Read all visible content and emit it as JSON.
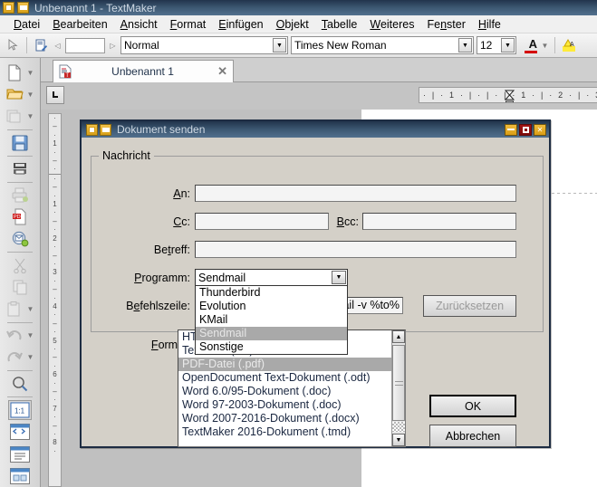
{
  "window": {
    "title": "Unbenannt 1 - TextMaker",
    "icons": [
      "app-grid-icon",
      "window-restore-icon"
    ]
  },
  "menubar": {
    "items": [
      {
        "label": "Datei",
        "accel": "D"
      },
      {
        "label": "Bearbeiten",
        "accel": "B"
      },
      {
        "label": "Ansicht",
        "accel": "A"
      },
      {
        "label": "Format",
        "accel": "F"
      },
      {
        "label": "Einfügen",
        "accel": "E"
      },
      {
        "label": "Objekt",
        "accel": "O"
      },
      {
        "label": "Tabelle",
        "accel": "T"
      },
      {
        "label": "Weiteres",
        "accel": "W"
      },
      {
        "label": "Fenster",
        "accel": "n"
      },
      {
        "label": "Hilfe",
        "accel": "H"
      }
    ]
  },
  "toolbar": {
    "style_value": "Normal",
    "font_value": "Times New Roman",
    "size_value": "12",
    "zoom_value": "",
    "font_color_letter": "A",
    "font_color_hex": "#d40000",
    "highlight_letter": "A",
    "highlight_hex": "#ffeb3b"
  },
  "tabbar": {
    "tabs": [
      {
        "label": "Unbenannt 1",
        "close": "✕"
      }
    ]
  },
  "ruler": {
    "horizontal_ticks": "· | · 1 · | · | · | · 1 · | · 2 · | · 3",
    "vertical_ticks_top": [
      "·",
      "–",
      "·",
      "1",
      "·",
      "–",
      "·"
    ],
    "vertical_ticks_body": [
      "·",
      "–",
      "·",
      "1",
      "·",
      "–",
      "·",
      "2",
      "·",
      "–",
      "·",
      "3",
      "·",
      "–",
      "·",
      "4",
      "·",
      "–",
      "·",
      "5",
      "·",
      "–",
      "·",
      "6",
      "·",
      "–",
      "·",
      "7",
      "·",
      "–",
      "·",
      "8",
      "·"
    ]
  },
  "lefttoolbar": {
    "items": [
      {
        "name": "new-document-icon",
        "has_arrow": true
      },
      {
        "name": "open-folder-icon",
        "has_arrow": true
      },
      {
        "name": "open-recent-icon",
        "has_arrow": true,
        "disabled": true
      },
      {
        "name": "save-icon",
        "has_arrow": false
      },
      {
        "name": "print-preview-icon",
        "has_arrow": false
      },
      {
        "name": "print-icon",
        "has_arrow": false,
        "disabled": true
      },
      {
        "name": "export-pdf-icon",
        "has_arrow": false
      },
      {
        "name": "send-document-icon",
        "has_arrow": false
      },
      {
        "name": "cut-icon",
        "has_arrow": false,
        "disabled": true
      },
      {
        "name": "copy-icon",
        "has_arrow": false,
        "disabled": true
      },
      {
        "name": "paste-icon",
        "has_arrow": true,
        "disabled": true
      },
      {
        "name": "undo-icon",
        "has_arrow": true,
        "disabled": true
      },
      {
        "name": "redo-icon",
        "has_arrow": true,
        "disabled": true
      },
      {
        "name": "zoom-icon",
        "has_arrow": false
      },
      {
        "name": "zoom-100-icon",
        "label": "1:1",
        "has_arrow": false
      },
      {
        "name": "view-sidebar-icon",
        "has_arrow": false
      },
      {
        "name": "view-page-icon",
        "has_arrow": false
      },
      {
        "name": "view-layout-icon",
        "has_arrow": false
      }
    ]
  },
  "dialog": {
    "title": "Dokument senden",
    "title_icons": [
      "app-grid-icon",
      "window-restore-icon"
    ],
    "controls": {
      "minimize": "minimize-button",
      "maximize": "maximize-button",
      "close": "close-button"
    },
    "group_nachricht": {
      "legend": "Nachricht",
      "fields": [
        {
          "label": "An:",
          "accel": "A",
          "value": ""
        },
        {
          "label": "Cc:",
          "accel": "C",
          "value": ""
        },
        {
          "label": "Bcc:",
          "accel": "B",
          "value": ""
        },
        {
          "label": "Betreff:",
          "accel": "t",
          "value": ""
        }
      ],
      "programm": {
        "label": "Programm:",
        "accel": "P",
        "value": "Sendmail",
        "options": [
          "Thunderbird",
          "Evolution",
          "KMail",
          "Sendmail",
          "Sonstige"
        ],
        "selected": "Sendmail",
        "expanded": true
      },
      "befehlszeile": {
        "label": "Befehlszeile:",
        "accel": "e",
        "value": ") | mail -v %to%"
      },
      "reset_button": {
        "label": "Zurücksetzen",
        "accel": "Z",
        "disabled": true
      }
    },
    "group_format": {
      "label": "Format:",
      "accel": "F",
      "options": [
        "TextMaker 2016-Dokument (.tmd)",
        "Word 2007-2016-Dokument (.docx)",
        "Word 97-2003-Dokument (.doc)",
        "Word 6.0/95-Dokument (.doc)",
        "OpenDocument Text-Dokument (.odt)",
        "PDF-Datei (.pdf)",
        "Textdatei (.txt)",
        "HTML-Datei (.htm)"
      ],
      "selected": "PDF-Datei (.pdf)",
      "scroll_up_icon": "arrow-up-icon",
      "scroll_down_icon": "arrow-down-icon"
    },
    "buttons": {
      "ok": "OK",
      "cancel": "Abbrechen"
    }
  },
  "colors": {
    "titlebar_dark": "#22344c",
    "titlebar_light": "#52708e",
    "dialog_face": "#d4d0c8",
    "selection": "#a9a9a9",
    "desktop": "#c0c0c0"
  }
}
